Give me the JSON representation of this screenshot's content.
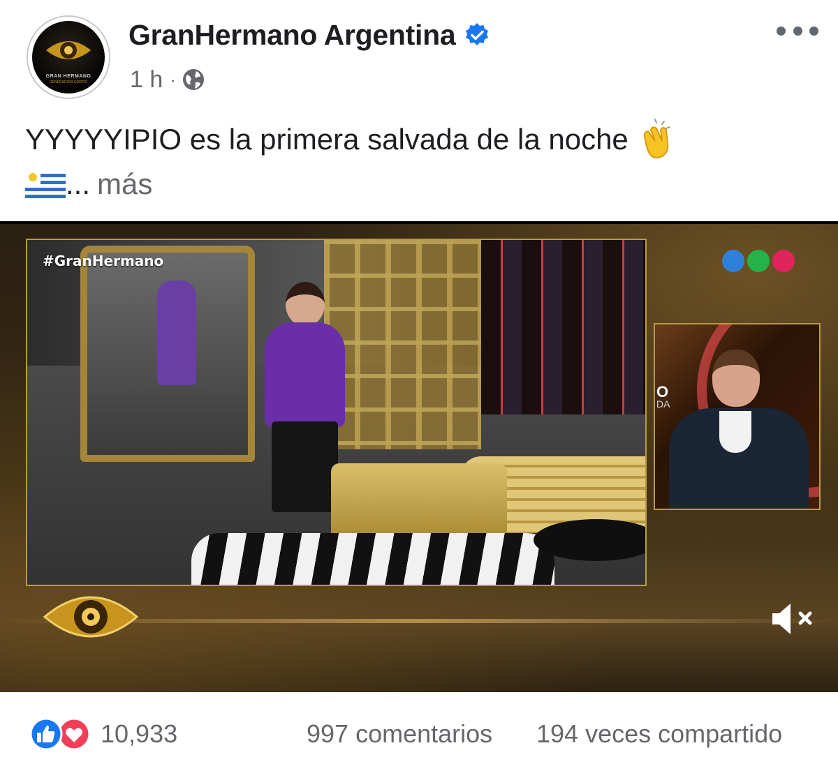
{
  "post": {
    "page_name": "GranHermano Argentina",
    "time": "1 h",
    "meta_separator": "·",
    "text_line1": "YYYYYIPIO es la primera salvada de la noche",
    "ellipsis": "...",
    "more_label": "más",
    "avatar_caption": "GRAN HERMANO",
    "avatar_subcaption": "GENERACIÓN CORPIC"
  },
  "video": {
    "hashtag": "#GranHermano",
    "side_text_1": "O",
    "side_text_2": "DA"
  },
  "stats": {
    "reaction_count": "10,933",
    "comments": "997 comentarios",
    "shares": "194 veces compartido"
  },
  "icons": {
    "verified": "verified-badge-icon",
    "privacy": "globe-icon",
    "more": "more-options-icon",
    "clap": "clapping-hands-icon",
    "flag": "uruguay-flag-icon",
    "mute": "muted-speaker-icon",
    "like": "like-reaction-icon",
    "love": "love-reaction-icon"
  },
  "colors": {
    "verified_blue": "#1877f2",
    "text_primary": "#1c1e21",
    "text_secondary": "#65676b",
    "love_red": "#f33e58",
    "gold": "#b99a48"
  }
}
